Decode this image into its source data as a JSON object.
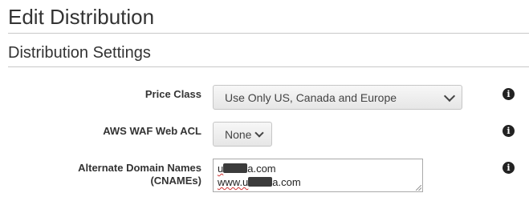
{
  "page": {
    "title": "Edit Distribution"
  },
  "section": {
    "title": "Distribution Settings"
  },
  "fields": {
    "price_class": {
      "label": "Price Class",
      "value": "Use Only US, Canada and Europe"
    },
    "waf": {
      "label": "AWS WAF Web ACL",
      "value": "None"
    },
    "cnames": {
      "label_line1": "Alternate Domain Names",
      "label_line2": "(CNAMEs)",
      "line1_prefix": "u",
      "line1_suffix": "a.com",
      "line2_prefix": "www.u",
      "line2_suffix": "a.com"
    }
  },
  "icons": {
    "info": "info-icon",
    "chevron": "chevron-down-icon"
  },
  "info_glyph": "i"
}
